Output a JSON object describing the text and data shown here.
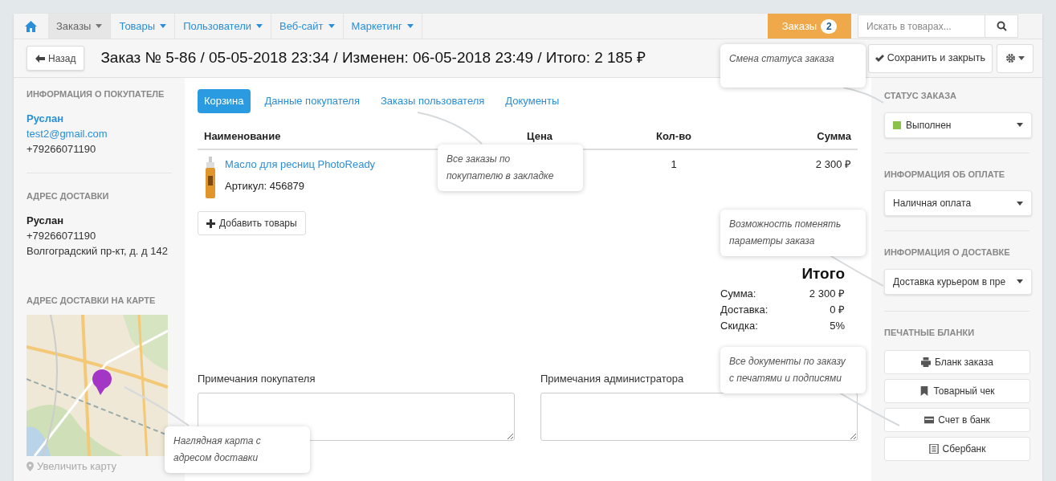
{
  "nav": {
    "items": [
      {
        "kind": "home",
        "selected": false
      },
      {
        "kind": "menu",
        "label": "Заказы",
        "selected": true
      },
      {
        "kind": "menu",
        "label": "Товары",
        "selected": false
      },
      {
        "kind": "menu",
        "label": "Пользователи",
        "selected": false
      },
      {
        "kind": "menu",
        "label": "Веб-сайт",
        "selected": false
      },
      {
        "kind": "menu",
        "label": "Маркетинг",
        "selected": false
      }
    ],
    "orders_button": {
      "label": "Заказы",
      "badge": "2"
    },
    "search": {
      "placeholder": "Искать в товарах..."
    }
  },
  "header": {
    "back_button": "Назад",
    "title": "Заказ № 5-86 / 05-05-2018 23:34 / Изменен: 06-05-2018 23:49 / Итого: 2 185 ₽",
    "save_button": "Сохранить и закрыть"
  },
  "customer": {
    "heading": "ИНФОРМАЦИЯ О ПОКУПАТЕЛЕ",
    "name": "Руслан",
    "email": "test2@gmail.com",
    "phone": "+79266071190"
  },
  "delivery": {
    "heading": "АДРЕС ДОСТАВКИ",
    "name": "Руслан",
    "phone": "+79266071190",
    "address": "Волгоградский пр-кт, д. д 142"
  },
  "map": {
    "heading": "АДРЕС ДОСТАВКИ НА КАРТЕ",
    "kind": "picture",
    "enlarge_link": "Увеличить карту"
  },
  "tabs": [
    {
      "label": "Корзина",
      "selected": true
    },
    {
      "label": "Данные покупателя",
      "selected": false
    },
    {
      "label": "Заказы пользователя",
      "selected": false
    },
    {
      "label": "Документы",
      "selected": false
    }
  ],
  "table": {
    "columns": [
      "Наименование",
      "Цена",
      "Кол-во",
      "Сумма"
    ],
    "rows": [
      {
        "name": "Масло для ресниц PhotoReady",
        "sku": "Артикул: 456879",
        "quantity": "1",
        "sum": "2 300 ₽"
      }
    ]
  },
  "add_button": "Добавить товары",
  "totals": {
    "heading": "Итого",
    "rows": [
      {
        "label": "Сумма:",
        "value": "2 300 ₽"
      },
      {
        "label": "Доставка:",
        "value": "0 ₽"
      },
      {
        "label": "Скидка:",
        "value": "5%"
      }
    ]
  },
  "notes": [
    {
      "label": "Примечания покупателя"
    },
    {
      "label": "Примечания администратора"
    }
  ],
  "status": {
    "heading": "СТАТУС ЗАКАЗА",
    "value": "Выполнен",
    "color": "#8bc34a"
  },
  "payment": {
    "heading": "ИНФОРМАЦИЯ ОБ ОПЛАТЕ",
    "value": "Наличная оплата"
  },
  "shipping": {
    "heading": "ИНФОРМАЦИЯ О ДОСТАВКЕ",
    "value": "Доставка курьером в пре"
  },
  "print_forms": {
    "heading": "ПЕЧАТНЫЕ БЛАНКИ",
    "buttons": [
      {
        "label": "Бланк заказа",
        "kind": "print"
      },
      {
        "label": "Товарный чек",
        "kind": "bookmark"
      },
      {
        "label": "Счет в банк",
        "kind": "card"
      },
      {
        "label": "Сбербанк",
        "kind": "list"
      }
    ]
  },
  "callouts": [
    {
      "text": "Смена статуса заказа"
    },
    {
      "text": "Все заказы по покупателю в закладке"
    },
    {
      "text": "Возможность поменять параметры заказа"
    },
    {
      "text": "Все документы по заказу с печатями и подписями"
    },
    {
      "text": "Наглядная карта с адресом доставки"
    }
  ]
}
